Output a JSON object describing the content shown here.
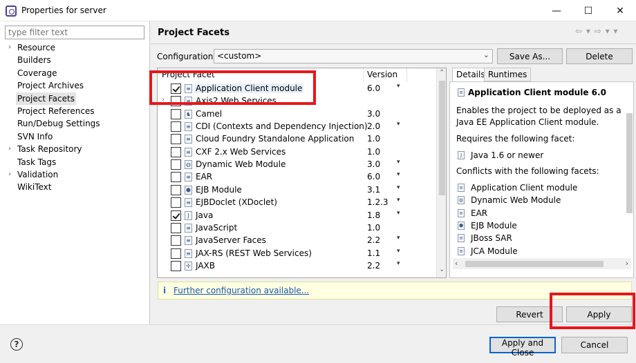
{
  "window": {
    "title": "Properties for server",
    "controls": [
      "—",
      "☐",
      "✕"
    ]
  },
  "tree": {
    "filter_placeholder": "type filter text",
    "items": [
      {
        "label": "Resource",
        "expandable": true
      },
      {
        "label": "Builders",
        "expandable": false
      },
      {
        "label": "Coverage",
        "expandable": false
      },
      {
        "label": "Project Archives",
        "expandable": false
      },
      {
        "label": "Project Facets",
        "expandable": false,
        "selected": true
      },
      {
        "label": "Project References",
        "expandable": false
      },
      {
        "label": "Run/Debug Settings",
        "expandable": false
      },
      {
        "label": "SVN Info",
        "expandable": false
      },
      {
        "label": "Task Repository",
        "expandable": true
      },
      {
        "label": "Task Tags",
        "expandable": false
      },
      {
        "label": "Validation",
        "expandable": true
      },
      {
        "label": "WikiText",
        "expandable": false
      }
    ]
  },
  "page": {
    "title": "Project Facets",
    "nav": "⇦ ▾ ⇨ ▾ ▾",
    "config_label": "Configuration:",
    "config_value": "<custom>",
    "save_as": "Save As...",
    "delete": "Delete"
  },
  "facets": {
    "col_name": "Project Facet",
    "col_version": "Version",
    "rows": [
      {
        "name": "Application Client module",
        "version": "6.0",
        "checked": true,
        "dropdown": true,
        "selected": true,
        "icon": "page-icon",
        "glyph": "≡"
      },
      {
        "name": "Axis2 Web Services",
        "version": "",
        "checked": false,
        "dropdown": false,
        "expand": true,
        "icon": "page-icon",
        "glyph": "≡"
      },
      {
        "name": "Camel",
        "version": "3.0",
        "checked": false,
        "dropdown": false,
        "icon": "camel-icon",
        "glyph": "♞"
      },
      {
        "name": "CDI (Contexts and Dependency Injection)",
        "version": "2.0",
        "checked": false,
        "dropdown": true,
        "icon": "page-icon",
        "glyph": "≡"
      },
      {
        "name": "Cloud Foundry Standalone Application",
        "version": "1.0",
        "checked": false,
        "dropdown": false,
        "icon": "page-icon",
        "glyph": "≡"
      },
      {
        "name": "CXF 2.x Web Services",
        "version": "1.0",
        "checked": false,
        "dropdown": false,
        "icon": "page-icon",
        "glyph": "≡"
      },
      {
        "name": "Dynamic Web Module",
        "version": "3.0",
        "checked": false,
        "dropdown": true,
        "icon": "web-module-icon",
        "glyph": "◍"
      },
      {
        "name": "EAR",
        "version": "6.0",
        "checked": false,
        "dropdown": true,
        "icon": "page-icon",
        "glyph": "≡"
      },
      {
        "name": "EJB Module",
        "version": "3.1",
        "checked": false,
        "dropdown": true,
        "icon": "ejb-icon",
        "glyph": "⬢"
      },
      {
        "name": "EJBDoclet (XDoclet)",
        "version": "1.2.3",
        "checked": false,
        "dropdown": true,
        "icon": "page-icon",
        "glyph": "≡"
      },
      {
        "name": "Java",
        "version": "1.8",
        "checked": true,
        "dropdown": true,
        "icon": "java-icon",
        "glyph": "J"
      },
      {
        "name": "JavaScript",
        "version": "1.0",
        "checked": false,
        "dropdown": false,
        "icon": "page-icon",
        "glyph": "≡"
      },
      {
        "name": "JavaServer Faces",
        "version": "2.2",
        "checked": false,
        "dropdown": true,
        "icon": "page-icon",
        "glyph": "≡"
      },
      {
        "name": "JAX-RS (REST Web Services)",
        "version": "1.1",
        "checked": false,
        "dropdown": true,
        "icon": "page-icon",
        "glyph": "≡"
      },
      {
        "name": "JAXB",
        "version": "2.2",
        "checked": false,
        "dropdown": true,
        "icon": "jaxb-icon",
        "glyph": "✢"
      }
    ]
  },
  "details": {
    "tab_details": "Details",
    "tab_runtimes": "Runtimes",
    "heading": "Application Client module 6.0",
    "desc1": "Enables the project to be deployed as a",
    "desc2": "Java EE Application Client module.",
    "requires_label": "Requires the following facet:",
    "requires": [
      {
        "name": "Java 1.6 or newer",
        "icon": "java-icon",
        "glyph": "J"
      }
    ],
    "conflicts_label": "Conflicts with the following facets:",
    "conflicts": [
      {
        "name": "Application Client module",
        "icon": "page-icon",
        "glyph": "≡"
      },
      {
        "name": "Dynamic Web Module",
        "icon": "web-module-icon",
        "glyph": "◍"
      },
      {
        "name": "EAR",
        "icon": "page-icon",
        "glyph": "≡"
      },
      {
        "name": "EJB Module",
        "icon": "ejb-icon",
        "glyph": "⬢"
      },
      {
        "name": "JBoss SAR",
        "icon": "page-icon",
        "glyph": "≡"
      },
      {
        "name": "JCA Module",
        "icon": "page-icon",
        "glyph": "≡"
      }
    ]
  },
  "info": {
    "icon": "i",
    "link": "Further configuration available..."
  },
  "buttons": {
    "revert": "Revert",
    "apply": "Apply",
    "apply_close": "Apply and Close",
    "cancel": "Cancel",
    "help": "?"
  },
  "colors": {
    "highlight": "#e8161c",
    "link": "#1a58b5",
    "info_bg": "#ffffe1"
  }
}
